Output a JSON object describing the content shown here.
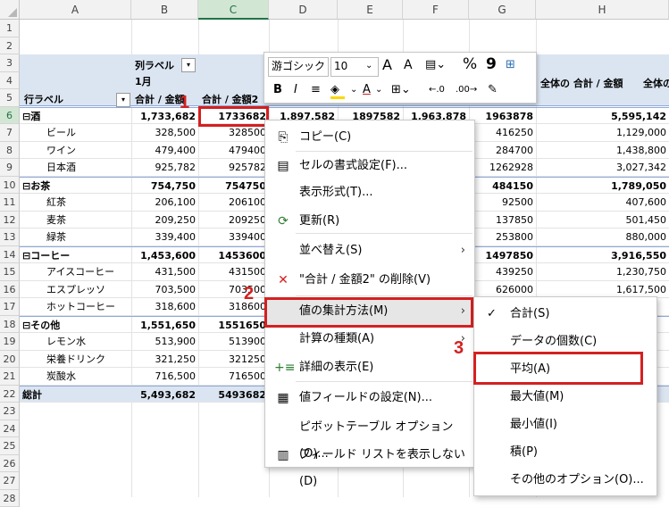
{
  "columns": [
    "A",
    "B",
    "C",
    "D",
    "E",
    "F",
    "G",
    "H"
  ],
  "rows": [
    "1",
    "2",
    "3",
    "4",
    "5",
    "6",
    "7",
    "8",
    "9",
    "10",
    "11",
    "12",
    "13",
    "14",
    "15",
    "16",
    "17",
    "18",
    "19",
    "20",
    "21",
    "22",
    "23",
    "24",
    "25",
    "26",
    "27",
    "28"
  ],
  "pivot": {
    "col_label": "列ラベル",
    "col_filter_icon": "dropdown-icon",
    "month": "1月",
    "row_label": "行ラベル",
    "h_sum1": "合計 / 金額",
    "h_sum2": "合計 / 金額2",
    "h_total1": "全体の 合計 / 金額",
    "h_total2": "全体の",
    "data": [
      {
        "r": "6",
        "a": "⊟酒",
        "b": "1,733,682",
        "c": "1733682",
        "d": "1,897,582",
        "e": "1897582",
        "f": "1,963,878",
        "g": "1963878",
        "h": "5,595,142",
        "kind": "cat"
      },
      {
        "r": "7",
        "a": "ビール",
        "b": "328,500",
        "c": "328500",
        "g": "416250",
        "h": "1,129,000"
      },
      {
        "r": "8",
        "a": "ワイン",
        "b": "479,400",
        "c": "479400",
        "g": "284700",
        "h": "1,438,800"
      },
      {
        "r": "9",
        "a": "日本酒",
        "b": "925,782",
        "c": "925782",
        "g": "1262928",
        "h": "3,027,342"
      },
      {
        "r": "10",
        "a": "⊟お茶",
        "b": "754,750",
        "c": "754750",
        "g": "484150",
        "h": "1,789,050",
        "kind": "cat"
      },
      {
        "r": "11",
        "a": "紅茶",
        "b": "206,100",
        "c": "206100",
        "g": "92500",
        "h": "407,600"
      },
      {
        "r": "12",
        "a": "麦茶",
        "b": "209,250",
        "c": "209250",
        "g": "137850",
        "h": "501,450"
      },
      {
        "r": "13",
        "a": "緑茶",
        "b": "339,400",
        "c": "339400",
        "g": "253800",
        "h": "880,000"
      },
      {
        "r": "14",
        "a": "⊟コーヒー",
        "b": "1,453,600",
        "c": "1453600",
        "g": "1497850",
        "h": "3,916,550",
        "kind": "cat"
      },
      {
        "r": "15",
        "a": "アイスコーヒー",
        "b": "431,500",
        "c": "431500",
        "g": "439250",
        "h": "1,230,750"
      },
      {
        "r": "16",
        "a": "エスプレッソ",
        "b": "703,500",
        "c": "703500",
        "g": "626000",
        "h": "1,617,500"
      },
      {
        "r": "17",
        "a": "ホットコーヒー",
        "b": "318,600",
        "c": "318600"
      },
      {
        "r": "18",
        "a": "⊟その他",
        "b": "1,551,650",
        "c": "1551650",
        "kind": "cat"
      },
      {
        "r": "19",
        "a": "レモン水",
        "b": "513,900",
        "c": "513900"
      },
      {
        "r": "20",
        "a": "栄養ドリンク",
        "b": "321,250",
        "c": "321250"
      },
      {
        "r": "21",
        "a": "炭酸水",
        "b": "716,500",
        "c": "716500"
      },
      {
        "r": "22",
        "a": "総計",
        "b": "5,493,682",
        "c": "5493682",
        "kind": "total"
      }
    ]
  },
  "mini_toolbar": {
    "font": "游ゴシック",
    "size": "10",
    "grow": "A",
    "shrink": "A",
    "bold": "B",
    "italic": "I",
    "percent": "%",
    "comma": "9"
  },
  "context_menu": {
    "items": [
      {
        "icon": "copy-icon",
        "glyph": "⎘",
        "label": "コピー(C)"
      },
      {
        "icon": "format-cells-icon",
        "glyph": "▤",
        "label": "セルの書式設定(F)..."
      },
      {
        "icon": "",
        "glyph": "",
        "label": "表示形式(T)..."
      },
      {
        "icon": "refresh-icon",
        "glyph": "⟳",
        "label": "更新(R)"
      },
      {
        "icon": "",
        "glyph": "",
        "label": "並べ替え(S)",
        "arrow": "›"
      },
      {
        "icon": "delete-icon",
        "glyph": "✕",
        "label": "\"合計 / 金額2\" の削除(V)"
      },
      {
        "icon": "",
        "glyph": "",
        "label": "値の集計方法(M)",
        "arrow": "›"
      },
      {
        "icon": "",
        "glyph": "",
        "label": "計算の種類(A)",
        "arrow": "›"
      },
      {
        "icon": "expand-icon",
        "glyph": "+≡",
        "label": "詳細の表示(E)"
      },
      {
        "icon": "field-settings-icon",
        "glyph": "▦",
        "label": "値フィールドの設定(N)..."
      },
      {
        "icon": "",
        "glyph": "",
        "label": "ピボットテーブル オプション(O)..."
      },
      {
        "icon": "field-list-icon",
        "glyph": "▥",
        "label": "フィールド リストを表示しない(D)"
      }
    ]
  },
  "submenu": {
    "check": "✓",
    "items": [
      "合計(S)",
      "データの個数(C)",
      "平均(A)",
      "最大値(M)",
      "最小値(I)",
      "積(P)",
      "その他のオプション(O)..."
    ]
  },
  "callouts": [
    "1",
    "2",
    "3"
  ],
  "colors": {
    "accent_red": "#d42020",
    "band": "#dbe5f1",
    "excel_green": "#217346"
  }
}
